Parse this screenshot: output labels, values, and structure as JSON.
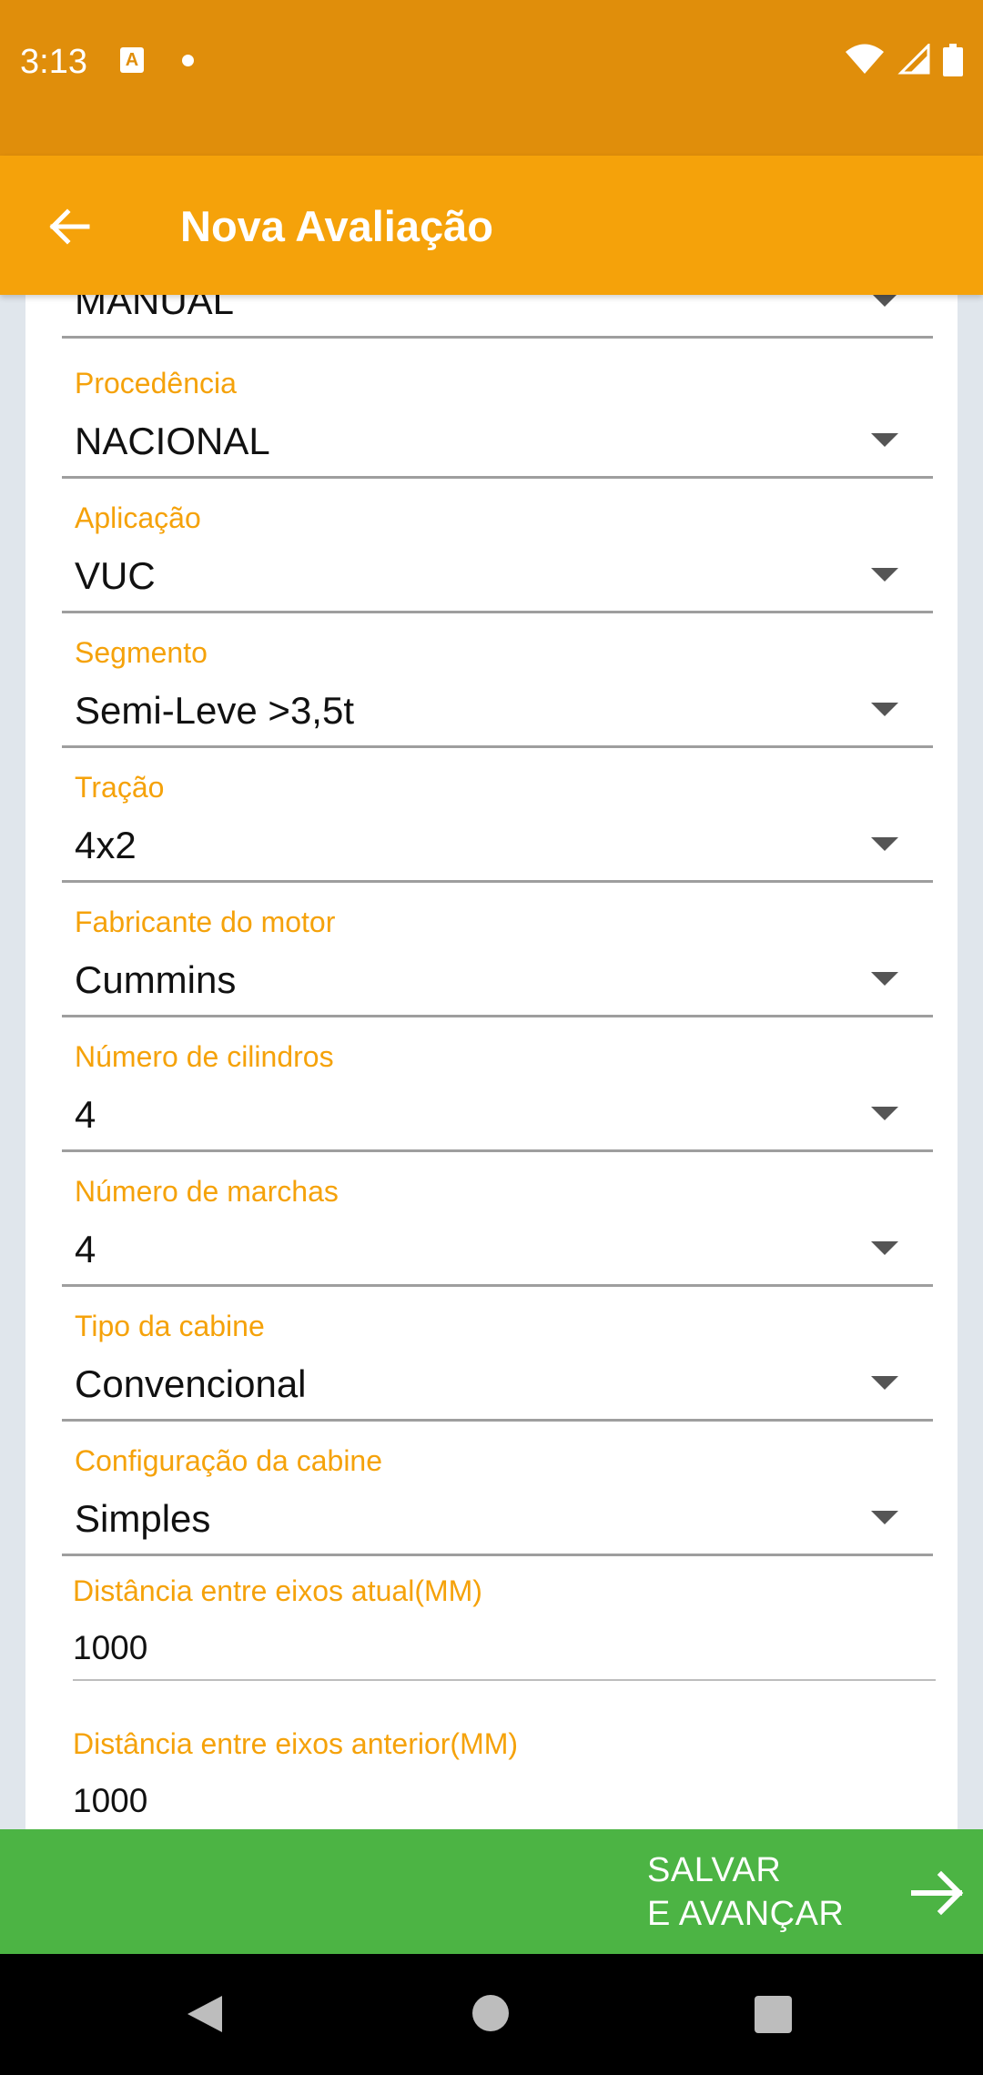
{
  "status_bar": {
    "time": "3:13",
    "notification_icon": "A",
    "icons": [
      "wifi-icon",
      "signal-icon",
      "battery-icon"
    ]
  },
  "app_bar": {
    "title": "Nova Avaliação",
    "back_icon": "arrow-left-icon"
  },
  "form": {
    "partial_value": "MANUAL",
    "fields": [
      {
        "label": "Procedência",
        "value": "NACIONAL"
      },
      {
        "label": "Aplicação",
        "value": "VUC"
      },
      {
        "label": "Segmento",
        "value": "Semi-Leve >3,5t"
      },
      {
        "label": "Tração",
        "value": "4x2"
      },
      {
        "label": "Fabricante do motor",
        "value": "Cummins"
      },
      {
        "label": "Número de cilindros",
        "value": "4"
      },
      {
        "label": "Número de marchas",
        "value": "4"
      },
      {
        "label": "Tipo da cabine",
        "value": "Convencional"
      },
      {
        "label": "Configuração da cabine",
        "value": "Simples"
      }
    ],
    "text_fields": [
      {
        "label": "Distância entre eixos atual(MM)",
        "value": "1000"
      },
      {
        "label": "Distância entre eixos anterior(MM)",
        "value": "1000"
      }
    ]
  },
  "footer": {
    "save_line1": "SALVAR",
    "save_line2": "E AVANÇAR",
    "save_icon": "arrow-right-icon"
  },
  "colors": {
    "status_bar": "#e08e0b",
    "app_bar": "#f5a20a",
    "accent_label": "#f5a20a",
    "save_bar": "#4cb444",
    "background": "#e0e6ec"
  }
}
